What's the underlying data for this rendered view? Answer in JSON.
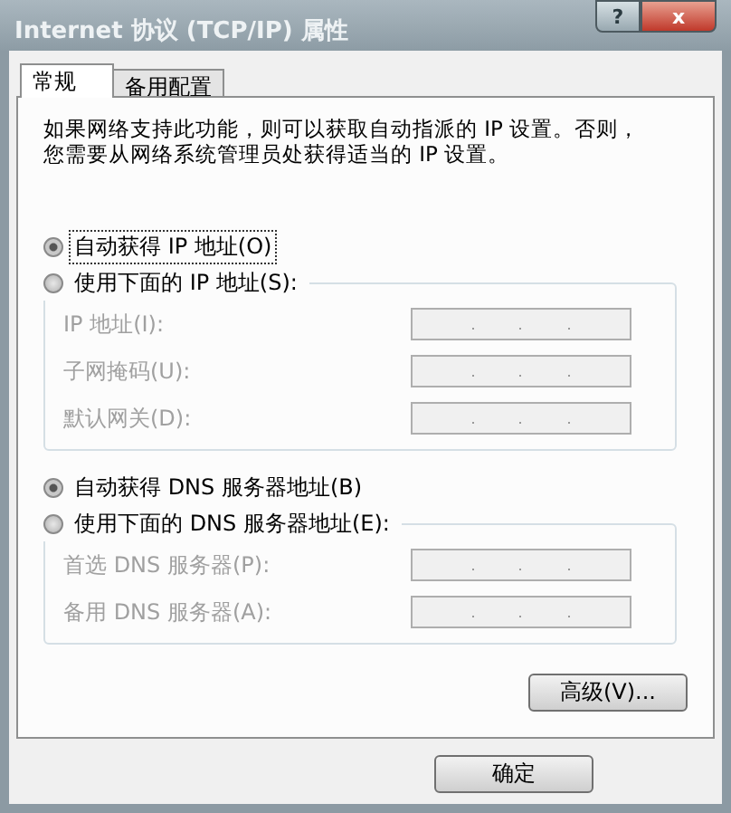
{
  "window": {
    "title": "Internet 协议 (TCP/IP) 属性",
    "help_button": "?",
    "close_button": "x"
  },
  "tabs": [
    {
      "label": "常规",
      "selected": true
    },
    {
      "label": "备用配置",
      "selected": false
    }
  ],
  "description": "如果网络支持此功能，则可以获取自动指派的 IP 设置。否则，您需要从网络系统管理员处获得适当的 IP 设置。",
  "ip_mode": [
    {
      "label": "自动获得 IP 地址(O)",
      "selected": true
    },
    {
      "label": "使用下面的 IP 地址(S):",
      "selected": false
    }
  ],
  "ip_fields": [
    {
      "label": "IP 地址(I):",
      "disabled": true
    },
    {
      "label": "子网掩码(U):",
      "disabled": true
    },
    {
      "label": "默认网关(D):",
      "disabled": true
    }
  ],
  "dns_mode": [
    {
      "label": "自动获得 DNS 服务器地址(B)",
      "selected": true
    },
    {
      "label": "使用下面的 DNS 服务器地址(E):",
      "selected": false
    }
  ],
  "dns_fields": [
    {
      "label": "首选 DNS 服务器(P):",
      "disabled": true
    },
    {
      "label": "备用 DNS 服务器(A):",
      "disabled": true
    }
  ],
  "advanced_button": "高级(V)...",
  "ok_button": "确定"
}
